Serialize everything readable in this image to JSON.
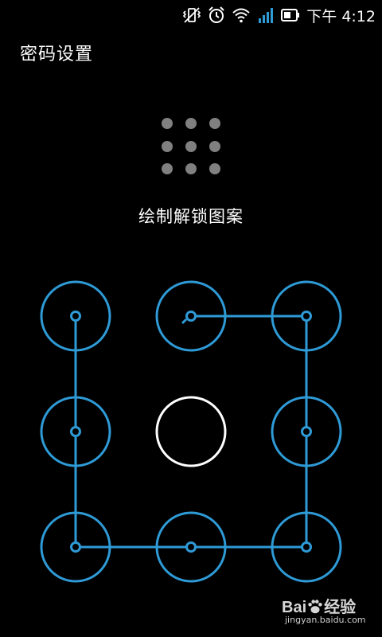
{
  "status_bar": {
    "time": "下午 4:12",
    "icons": [
      "vibrate-muted-icon",
      "alarm-clock-icon",
      "wifi-icon",
      "signal-icon",
      "battery-icon"
    ]
  },
  "header": {
    "title": "密码设置"
  },
  "instruction": "绘制解锁图案",
  "pattern": {
    "accent_color": "#2e9ad6",
    "active_ring_color": "#ffffff",
    "preview_dot_color": "#808080",
    "nodes": [
      {
        "row": 1,
        "col": 1,
        "state": "selected"
      },
      {
        "row": 1,
        "col": 2,
        "state": "selected"
      },
      {
        "row": 1,
        "col": 3,
        "state": "selected"
      },
      {
        "row": 2,
        "col": 1,
        "state": "selected"
      },
      {
        "row": 2,
        "col": 2,
        "state": "active"
      },
      {
        "row": 2,
        "col": 3,
        "state": "selected"
      },
      {
        "row": 3,
        "col": 1,
        "state": "selected"
      },
      {
        "row": 3,
        "col": 2,
        "state": "selected"
      },
      {
        "row": 3,
        "col": 3,
        "state": "selected"
      }
    ],
    "drawn_path": [
      [
        1,
        2
      ],
      [
        1,
        3
      ],
      [
        2,
        3
      ],
      [
        3,
        3
      ],
      [
        3,
        2
      ],
      [
        3,
        1
      ],
      [
        2,
        1
      ],
      [
        1,
        1
      ]
    ]
  },
  "watermark": {
    "logo": "Bai du 经验",
    "logo_left": "Bai",
    "logo_right": "经验",
    "url": "jingyan.baidu.com"
  }
}
